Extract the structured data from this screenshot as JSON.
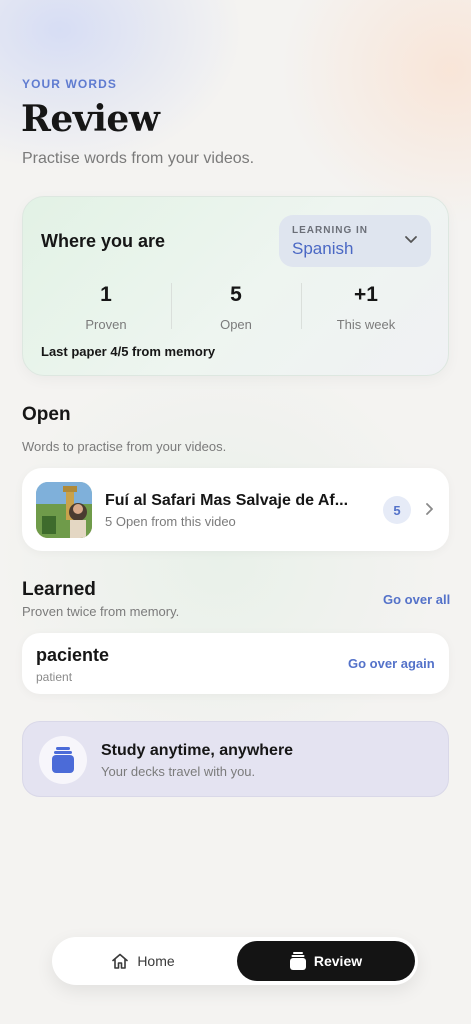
{
  "header": {
    "eyebrow": "YOUR WORDS",
    "title": "Review",
    "subtitle": "Practise words from your videos."
  },
  "status": {
    "title": "Where you are",
    "language_caption": "LEARNING IN",
    "language": "Spanish",
    "stats": [
      {
        "value": "1",
        "label": "Proven"
      },
      {
        "value": "5",
        "label": "Open"
      },
      {
        "value": "+1",
        "label": "This week"
      }
    ],
    "last_paper": "Last paper 4/5 from memory"
  },
  "open_section": {
    "heading": "Open",
    "subtitle": "Words to practise from your videos.",
    "videos": [
      {
        "title": "Fuí al Safari Mas Salvaje de Af...",
        "subtitle": "5 Open from this video",
        "count": "5"
      }
    ]
  },
  "learned_section": {
    "heading": "Learned",
    "subtitle": "Proven twice from memory.",
    "go_over_all": "Go over all",
    "words": [
      {
        "word": "paciente",
        "translation": "patient",
        "action": "Go over again"
      }
    ]
  },
  "promo": {
    "title": "Study anytime, anywhere",
    "subtitle": "Your decks travel with you."
  },
  "tabbar": {
    "home": "Home",
    "review": "Review",
    "active": "review"
  },
  "colors": {
    "accent": "#5472c9",
    "active_tab": "#141414"
  }
}
